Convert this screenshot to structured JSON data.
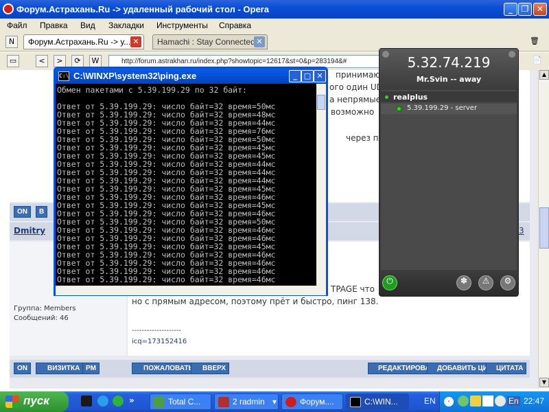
{
  "opera": {
    "title": "Форум.Астрахань.Ru -> удаленный рабочий стол - Opera",
    "menu": [
      "Файл",
      "Правка",
      "Вид",
      "Закладки",
      "Инструменты",
      "Справка"
    ],
    "tabs": [
      {
        "label": "Форум.Астрахань.Ru -> у..."
      },
      {
        "label": "Hamachi : Stay Connected"
      }
    ],
    "address": "http://forum.astrakhan.ru/index.php?showtopic=12617&st=0&p=283194&#"
  },
  "forum": {
    "snippets": [
      "принимаю",
      "ого один UD",
      "а непрямые",
      "возможно",
      "через пром"
    ],
    "post_buttons_top": [
      "ON",
      "В"
    ],
    "author": "Dmitry",
    "author_num": "3",
    "group": "Группа: Members",
    "messages": "Сообщений: 46",
    "post_tail_1": "TPAGE что",
    "post_line_2": "но с прямым адресом, поэтому прёт и быстро, пинг 138.",
    "separator": "--------------------",
    "icq": "icq=173152416",
    "buttons_bottom_left": [
      "ON",
      "ВИЗИТКА",
      "PM"
    ],
    "buttons_bottom_mid": [
      "ПОЖАЛОВАТЬСЯ",
      "ВВЕРХ"
    ],
    "buttons_bottom_right": [
      "РЕДАКТИРОВАТЬ",
      "ДОБАВИТЬ ЦИТАТУ",
      "ЦИТАТА"
    ]
  },
  "cmd": {
    "title": "C:\\WINXP\\system32\\ping.exe",
    "header": "Обмен пакетами с 5.39.199.29 по 32 байт:",
    "lines": [
      "Ответ от 5.39.199.29: число байт=32 время=50мс",
      "Ответ от 5.39.199.29: число байт=32 время=48мс",
      "Ответ от 5.39.199.29: число байт=32 время=44мс",
      "Ответ от 5.39.199.29: число байт=32 время=76мс",
      "Ответ от 5.39.199.29: число байт=32 время=50мс",
      "Ответ от 5.39.199.29: число байт=32 время=45мс",
      "Ответ от 5.39.199.29: число байт=32 время=45мс",
      "Ответ от 5.39.199.29: число байт=32 время=44мс",
      "Ответ от 5.39.199.29: число байт=32 время=44мс",
      "Ответ от 5.39.199.29: число байт=32 время=44мс",
      "Ответ от 5.39.199.29: число байт=32 время=45мс",
      "Ответ от 5.39.199.29: число байт=32 время=46мс",
      "Ответ от 5.39.199.29: число байт=32 время=45мс",
      "Ответ от 5.39.199.29: число байт=32 время=46мс",
      "Ответ от 5.39.199.29: число байт=32 время=50мс",
      "Ответ от 5.39.199.29: число байт=32 время=46мс",
      "Ответ от 5.39.199.29: число байт=32 время=46мс",
      "Ответ от 5.39.199.29: число байт=32 время=45мс",
      "Ответ от 5.39.199.29: число байт=32 время=46мс",
      "Ответ от 5.39.199.29: число байт=32 время=46мс",
      "Ответ от 5.39.199.29: число байт=32 время=46мс",
      "Ответ от 5.39.199.29: число байт=32 время=46мс"
    ]
  },
  "hamachi": {
    "ip": "5.32.74.219",
    "nick": "Mr.Svin -- away",
    "network": "realplus",
    "peer": "5.39.199.29 - server"
  },
  "taskbar": {
    "start": "пуск",
    "buttons": [
      "Total C...",
      "2 radmin",
      "Форум....",
      "C:\\WIN..."
    ],
    "lang_left": "EN",
    "lang_right": "En",
    "clock": "22:47"
  },
  "colors": {
    "xp_blue": "#0a4fd6",
    "hamachi_bg": "#3c3c3c",
    "online_green": "#39d02a",
    "forum_button": "#3b6eb0"
  }
}
